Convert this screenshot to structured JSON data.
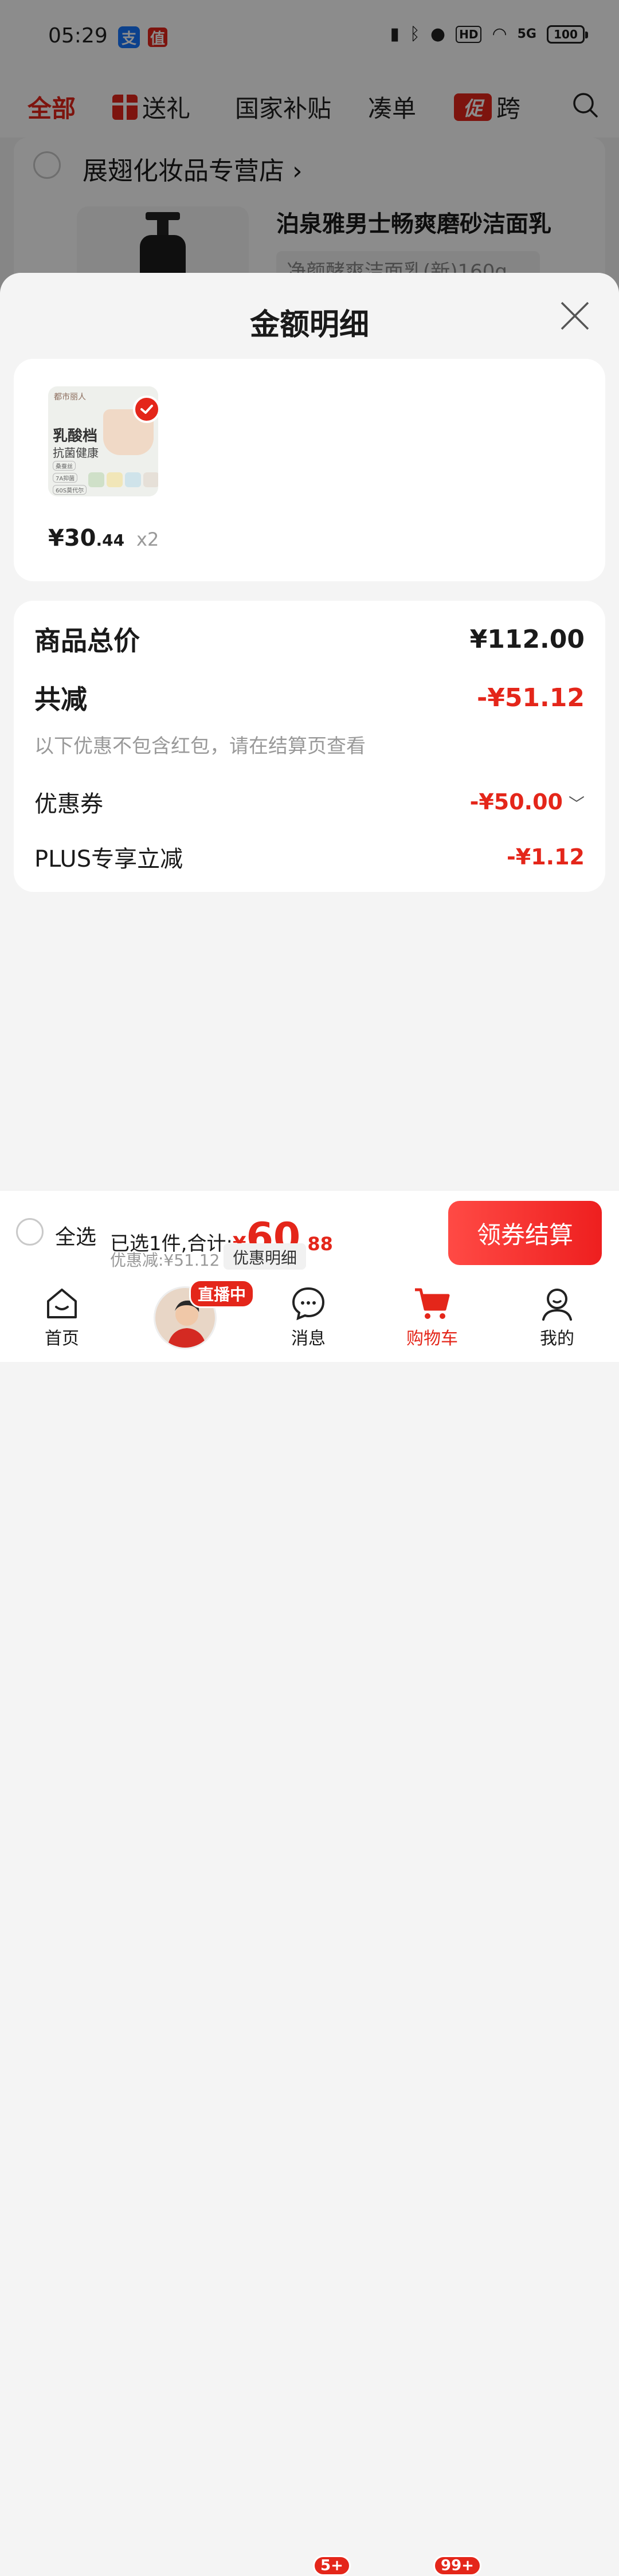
{
  "status_bar": {
    "time": "05:29",
    "battery": "100",
    "hd": "HD",
    "network": "5G"
  },
  "top_tabs": [
    {
      "label": "全部",
      "active": true
    },
    {
      "label": "送礼"
    },
    {
      "label": "国家补贴"
    },
    {
      "label": "凑单"
    },
    {
      "label": "跨",
      "badge": "促"
    }
  ],
  "background_store": {
    "name": "展翅化妆品专营店",
    "product_title": "泊泉雅男士畅爽磨砂洁面乳",
    "product_spec": "净颜酵爽洁面乳(新)160g"
  },
  "sheet": {
    "title": "金额明细",
    "item": {
      "thumb_brand": "都市丽人",
      "thumb_title": "乳酸档",
      "thumb_subtitle": "抗菌健康",
      "thumb_chips": [
        "桑蚕丝",
        "7A抑菌",
        "60S莫代尔"
      ],
      "price_int": "¥30",
      "price_dec": ".44",
      "quantity": "x2"
    },
    "summary": {
      "total_label": "商品总价",
      "total_value": "¥112.00",
      "reduce_label": "共减",
      "reduce_value": "-¥51.12",
      "note": "以下优惠不包含红包，请在结算页查看",
      "coupon_label": "优惠券",
      "coupon_value": "-¥50.00",
      "plus_label": "PLUS专享立减",
      "plus_value": "-¥1.12"
    }
  },
  "bottom_bar": {
    "select_all": "全选",
    "selected_text": "已选1件,合计:",
    "yen": "¥",
    "total_int": "60",
    "total_dec": ".88",
    "discount_text": "优惠减:¥51.12",
    "detail_button": "优惠明细",
    "checkout_button": "领券结算"
  },
  "nav": {
    "home": "首页",
    "live_badge": "直播中",
    "messages": "消息",
    "messages_badge": "5+",
    "cart": "购物车",
    "cart_badge": "99+",
    "mine": "我的"
  },
  "colors": {
    "accent": "#e4261a",
    "sheet_bg": "#f4f4f4"
  }
}
